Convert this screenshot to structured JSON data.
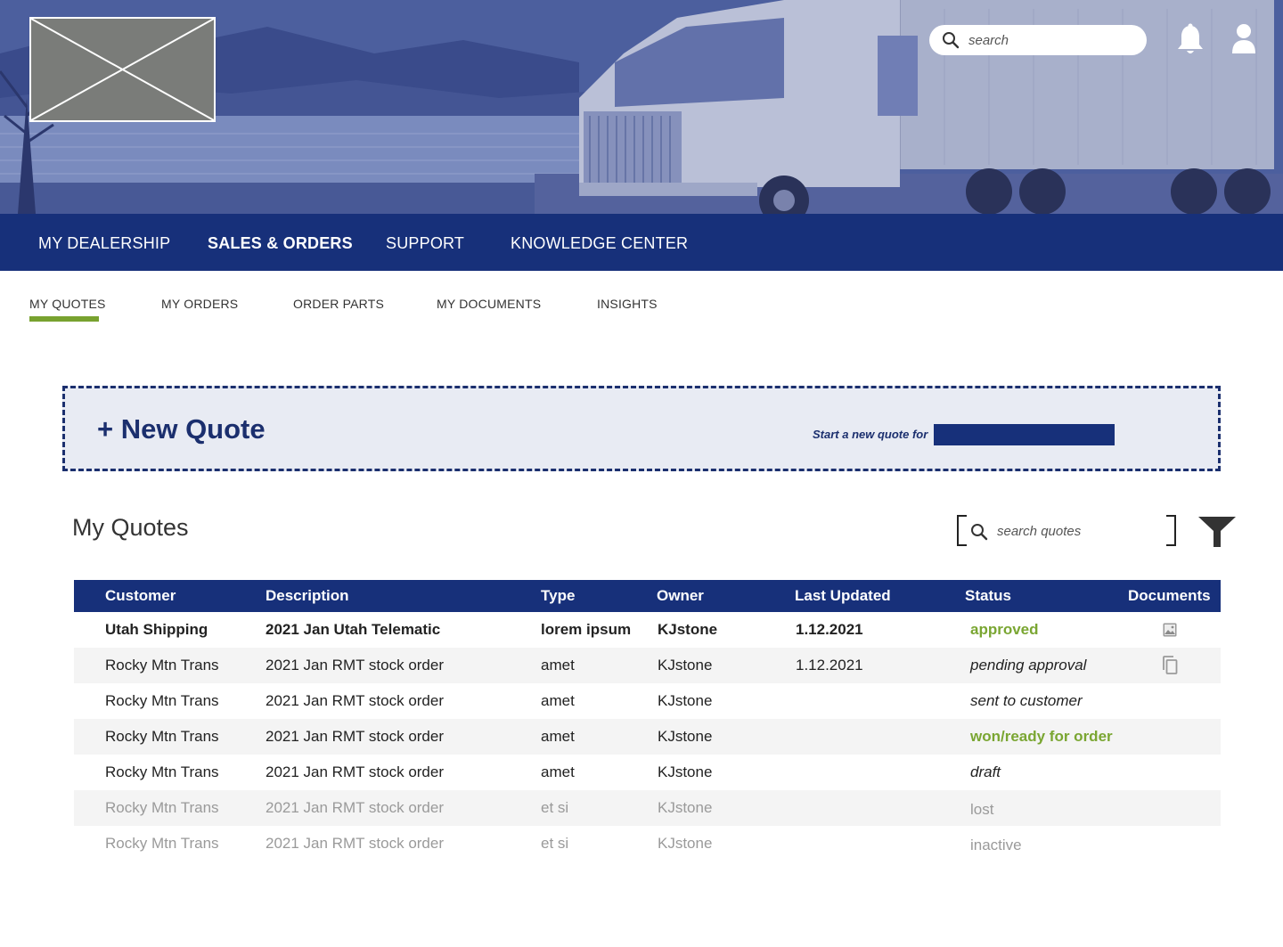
{
  "header": {
    "logo_alt": "",
    "search_placeholder": "search"
  },
  "main_nav": {
    "items": [
      {
        "label": "MY DEALERSHIP",
        "active": false
      },
      {
        "label": "SALES & ORDERS",
        "active": true
      },
      {
        "label": "SUPPORT",
        "active": false
      },
      {
        "label": "KNOWLEDGE CENTER",
        "active": false
      }
    ]
  },
  "sub_nav": {
    "tabs": [
      {
        "label": "MY QUOTES",
        "active": true
      },
      {
        "label": "MY ORDERS",
        "active": false
      },
      {
        "label": "ORDER PARTS",
        "active": false
      },
      {
        "label": "MY DOCUMENTS",
        "active": false
      },
      {
        "label": "INSIGHTS",
        "active": false
      }
    ]
  },
  "new_quote": {
    "label": "+ New Quote",
    "start_text": "Start a new quote for",
    "dealer_value": ""
  },
  "my_quotes": {
    "title": "My Quotes",
    "search_placeholder": "search quotes",
    "columns": [
      "Customer",
      "Description",
      "Type",
      "Owner",
      "Last Updated",
      "Status",
      "Documents"
    ],
    "rows": [
      {
        "customer": "Utah Shipping",
        "description": "2021 Jan Utah Telematic",
        "type": "lorem ipsum",
        "owner": "KJstone",
        "last_updated": "1.12.2021",
        "status": "approved",
        "document_icon": "image-icon"
      },
      {
        "customer": "Rocky Mtn Trans",
        "description": "2021 Jan RMT stock order",
        "type": "amet",
        "owner": "KJstone",
        "last_updated": "1.12.2021",
        "status": "pending approval",
        "document_icon": "copy-icon"
      },
      {
        "customer": "Rocky Mtn Trans",
        "description": "2021 Jan RMT stock order",
        "type": "amet",
        "owner": "KJstone",
        "last_updated": "",
        "status": "sent to customer",
        "document_icon": ""
      },
      {
        "customer": "Rocky Mtn Trans",
        "description": "2021 Jan RMT stock order",
        "type": "amet",
        "owner": "KJstone",
        "last_updated": "",
        "status": "won/ready for order",
        "document_icon": ""
      },
      {
        "customer": "Rocky Mtn Trans",
        "description": "2021 Jan RMT stock order",
        "type": "amet",
        "owner": "KJstone",
        "last_updated": "",
        "status": "draft",
        "document_icon": ""
      },
      {
        "customer": "Rocky Mtn Trans",
        "description": "2021 Jan RMT stock order",
        "type": "et si",
        "owner": "KJstone",
        "last_updated": "",
        "status": "lost",
        "document_icon": ""
      },
      {
        "customer": "Rocky Mtn Trans",
        "description": "2021 Jan RMT stock order",
        "type": "et si",
        "owner": "KJstone",
        "last_updated": "",
        "status": "inactive",
        "document_icon": ""
      }
    ]
  },
  "colors": {
    "brand_navy": "#17307a",
    "accent_green": "#78a22f",
    "status_green": "#7aa632",
    "faded_text": "#9a9a9a",
    "banner_bg": "#e8ebf3"
  }
}
